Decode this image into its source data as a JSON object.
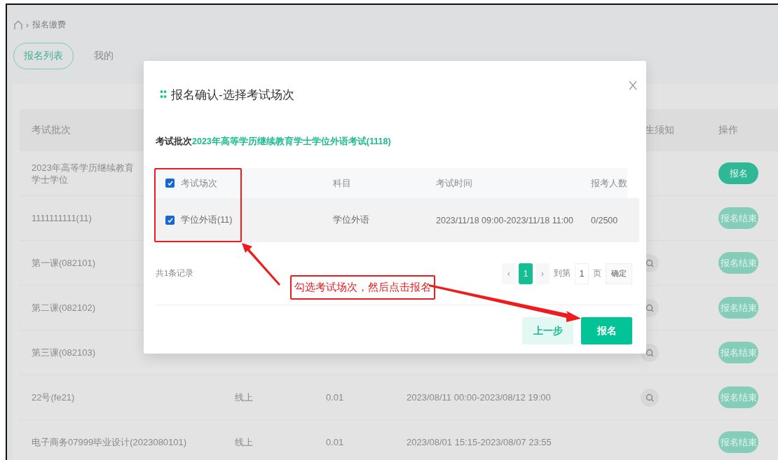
{
  "breadcrumb": {
    "separator": "›",
    "items": [
      "报名缴费"
    ]
  },
  "tabs": [
    {
      "label": "报名列表",
      "selected": true
    },
    {
      "label": "我的",
      "selected": false
    }
  ],
  "table": {
    "columns": {
      "batch": "考试批次",
      "notice": "生须知",
      "action": "操作"
    },
    "rows": [
      {
        "batch": "2023年高等学历继续教育学士学位",
        "notice_link": false,
        "action": {
          "label": "报名",
          "disabled": false
        }
      },
      {
        "batch": "1111111111(11)",
        "notice_link": false,
        "action": {
          "label": "报名结束",
          "disabled": true
        }
      },
      {
        "batch": "第一课(082101)",
        "notice_link": true,
        "action": {
          "label": "报名结束",
          "disabled": true
        }
      },
      {
        "batch": "第二课(082102)",
        "notice_link": true,
        "action": {
          "label": "报名结束",
          "disabled": true
        }
      },
      {
        "batch": "第三课(082103)",
        "notice_link": true,
        "action": {
          "label": "报名结束",
          "disabled": true
        }
      },
      {
        "batch": "22号(fe21)",
        "mode": "线上",
        "fee": "0.01",
        "time": "2023/08/11 00:00-2023/08/12 19:00",
        "notice_link": true,
        "action": {
          "label": "报名结束",
          "disabled": true
        }
      },
      {
        "batch": "电子商务07999毕业设计(2023080101)",
        "mode": "线上",
        "fee": "0.01",
        "time": "2023/08/01 15:15-2023/08/07 23:55",
        "notice_link": false,
        "action": {
          "label": "报名结束",
          "disabled": true
        }
      }
    ]
  },
  "modal": {
    "title": "报名确认-选择考试场次",
    "batch_label": "考试批次",
    "batch_value": "2023年高等学历继续教育学士学位外语考试(1118)",
    "columns": [
      "考试场次",
      "科目",
      "考试时间",
      "报考人数"
    ],
    "header_checked": true,
    "rows": [
      {
        "session": "学位外语(11)",
        "subject": "学位外语",
        "time": "2023/11/18 09:00-2023/11/18 11:00",
        "count": "0/2500",
        "checked": true
      }
    ],
    "total": "共1条记录",
    "pagination": {
      "prev": "‹",
      "pages": [
        {
          "label": "1",
          "selected": true
        }
      ],
      "next": "›",
      "goto_label": "到第",
      "goto_value": "1",
      "page_unit": "页",
      "confirm": "确定"
    },
    "buttons": [
      {
        "label": "上一步",
        "kind": "secondary"
      },
      {
        "label": "报名",
        "kind": "primary"
      }
    ]
  },
  "annotation": {
    "callout": "勾选考试场次，然后点击报名"
  }
}
